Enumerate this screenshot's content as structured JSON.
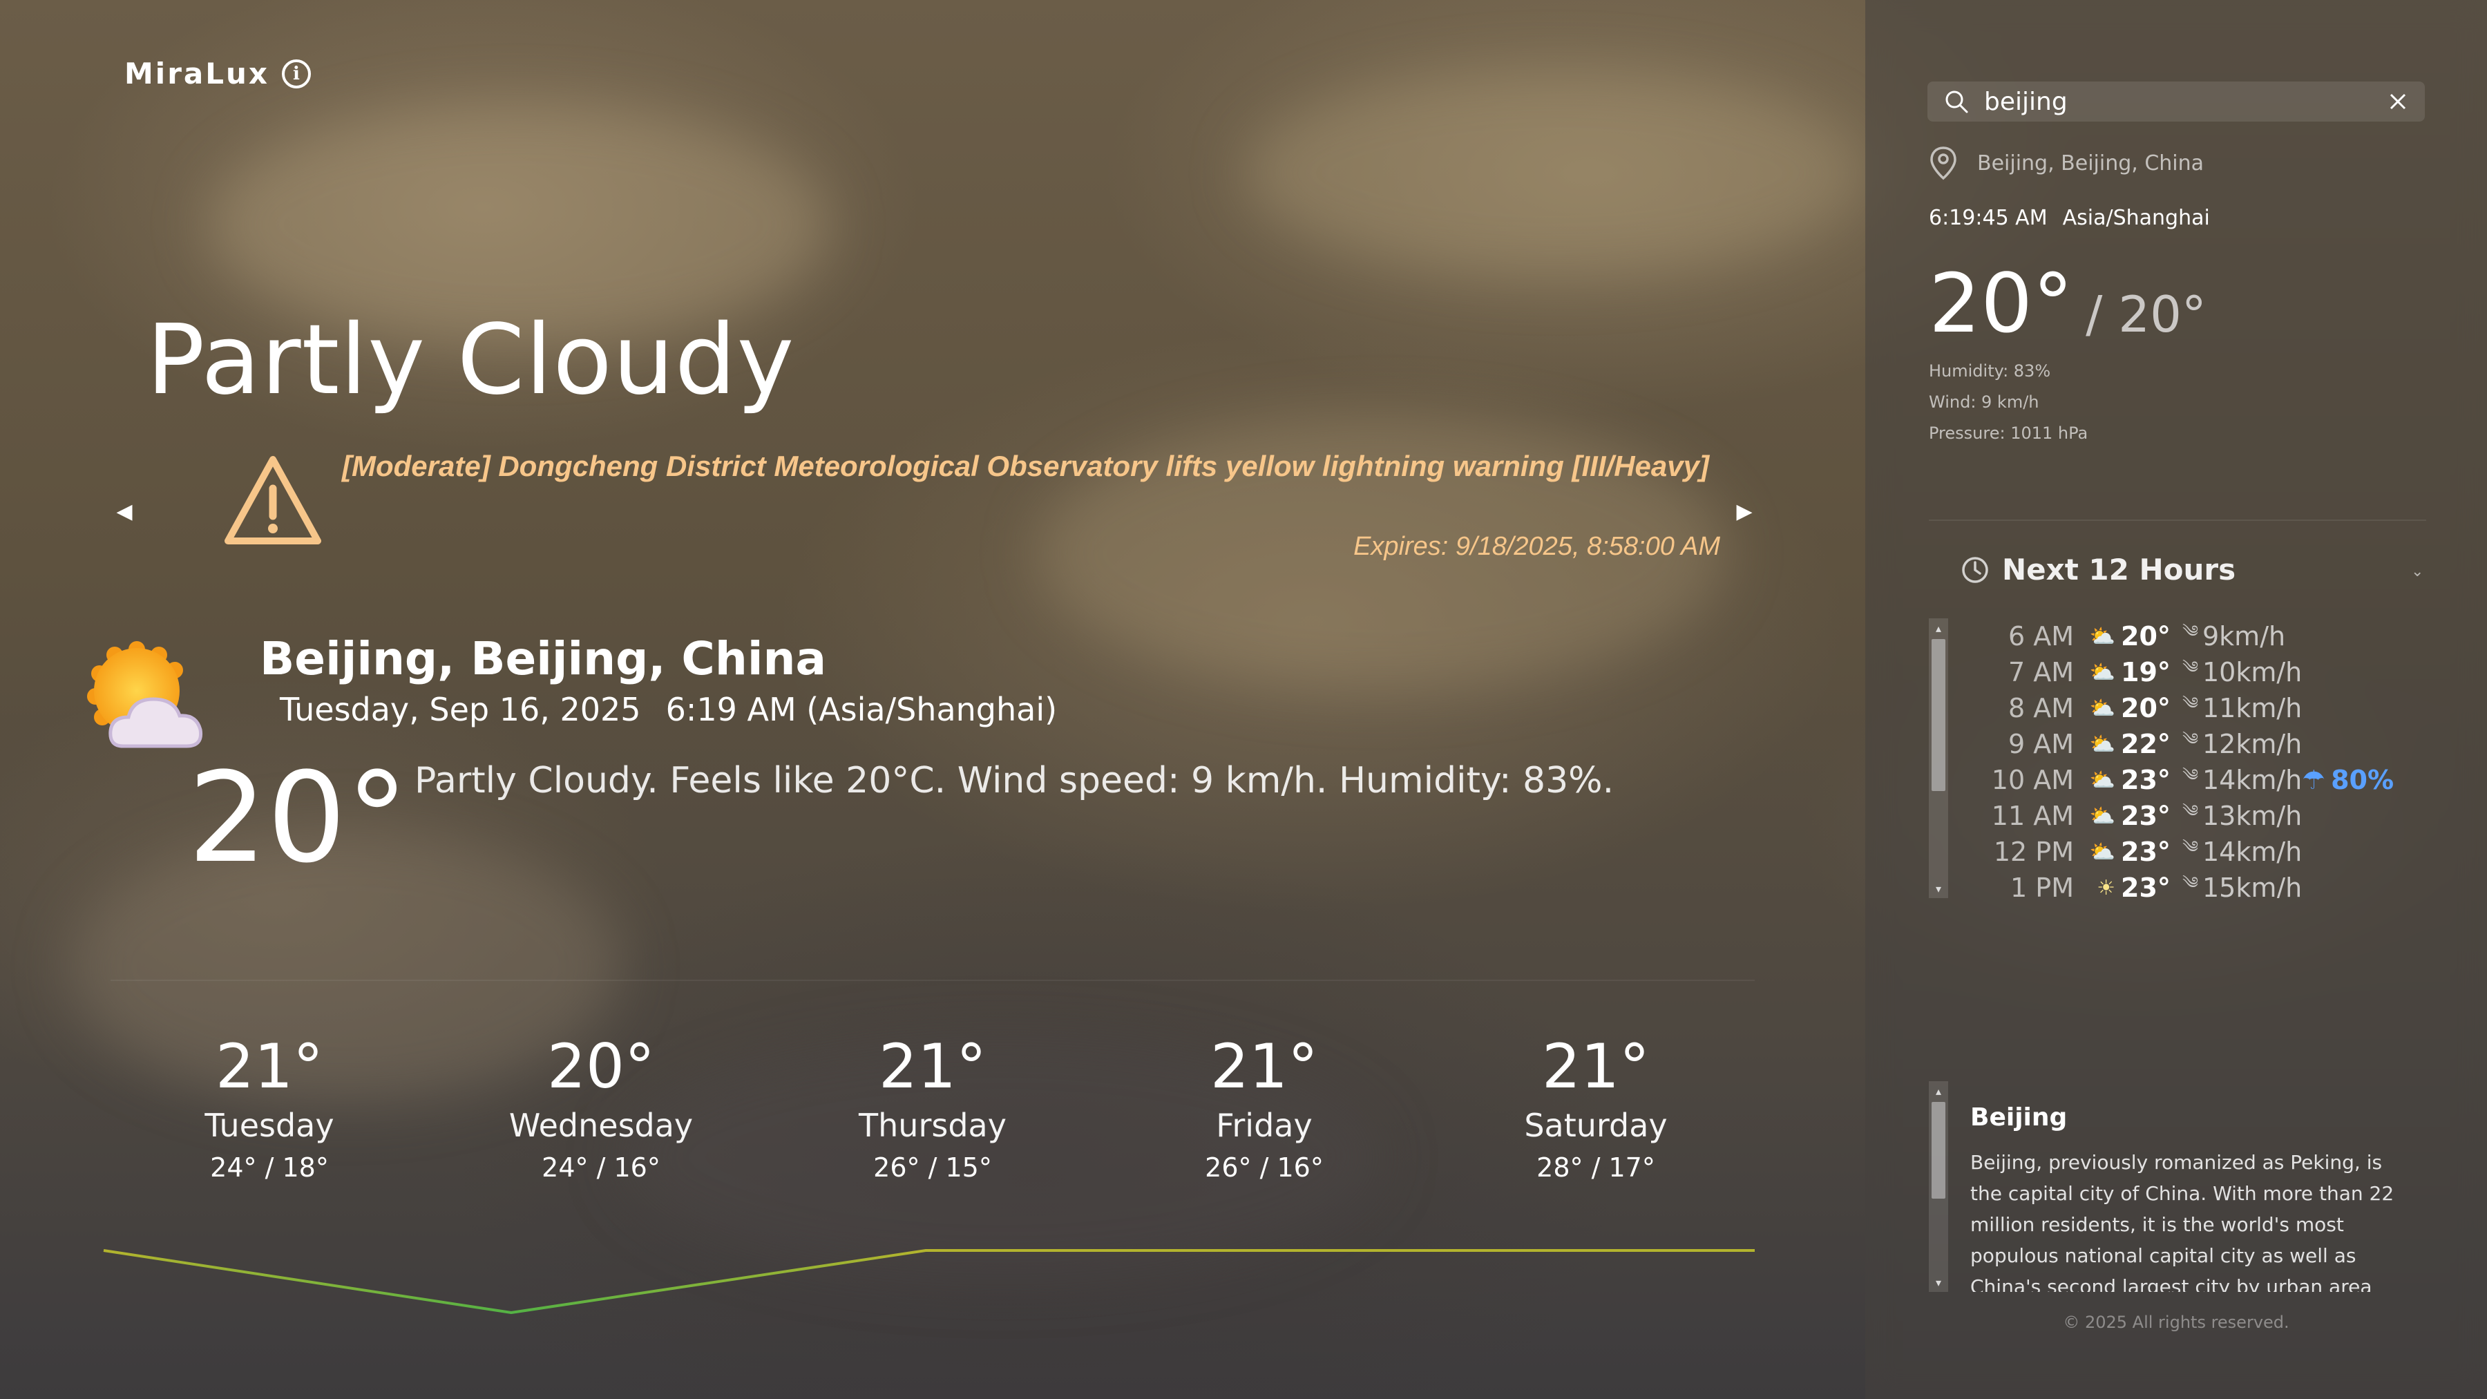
{
  "app": {
    "brand": "MiraLux"
  },
  "current": {
    "condition": "Partly Cloudy",
    "location": "Beijing, Beijing, China",
    "date": "Tuesday, Sep 16, 2025",
    "time": "6:19 AM (Asia/Shanghai)",
    "temp": "20°",
    "summary": "Partly Cloudy. Feels like 20°C. Wind speed: 9 km/h. Humidity: 83%."
  },
  "alert": {
    "text": "[Moderate] Dongcheng District Meteorological Observatory lifts yellow lightning warning [III/Heavy]",
    "expires": "Expires: 9/18/2025, 8:58:00 AM",
    "prev": "◀",
    "next": "▶"
  },
  "forecast": [
    {
      "temp": "21°",
      "day": "Tuesday",
      "range": "24° / 18°"
    },
    {
      "temp": "20°",
      "day": "Wednesday",
      "range": "24° / 16°"
    },
    {
      "temp": "21°",
      "day": "Thursday",
      "range": "26° / 15°"
    },
    {
      "temp": "21°",
      "day": "Friday",
      "range": "26° / 16°"
    },
    {
      "temp": "21°",
      "day": "Saturday",
      "range": "28° / 17°"
    }
  ],
  "panel": {
    "search_value": "beijing",
    "location": "Beijing, Beijing, China",
    "clock_time": "6:19:45 AM",
    "timezone": "Asia/Shanghai",
    "temp": "20°",
    "temp_sub": "/ 20°",
    "humidity": "Humidity: 83%",
    "wind": "Wind: 9 km/h",
    "pressure": "Pressure: 1011 hPa",
    "hours_title": "Next 12 Hours",
    "hours": [
      {
        "time": "6 AM",
        "icon": "cloud-sun-icon",
        "glyph": "⛅",
        "temp": "20°",
        "wind": "9km/h"
      },
      {
        "time": "7 AM",
        "icon": "cloud-sun-icon",
        "glyph": "⛅",
        "temp": "19°",
        "wind": "10km/h"
      },
      {
        "time": "8 AM",
        "icon": "cloud-sun-icon",
        "glyph": "⛅",
        "temp": "20°",
        "wind": "11km/h"
      },
      {
        "time": "9 AM",
        "icon": "cloud-sun-icon",
        "glyph": "⛅",
        "temp": "22°",
        "wind": "12km/h"
      },
      {
        "time": "10 AM",
        "icon": "cloud-sun-icon",
        "glyph": "⛅",
        "temp": "23°",
        "wind": "14km/h",
        "rain": "80%"
      },
      {
        "time": "11 AM",
        "icon": "cloud-sun-icon",
        "glyph": "⛅",
        "temp": "23°",
        "wind": "13km/h"
      },
      {
        "time": "12 PM",
        "icon": "cloud-sun-icon",
        "glyph": "⛅",
        "temp": "23°",
        "wind": "14km/h"
      },
      {
        "time": "1 PM",
        "icon": "sun-icon",
        "glyph": "☀",
        "temp": "23°",
        "wind": "15km/h"
      }
    ],
    "wiki_title": "Beijing",
    "wiki_text": "Beijing, previously romanized as Peking, is the capital city of China. With more than 22 million residents, it is the world's most populous national capital city as well as China's second largest city by urban area after Shanghai. It is"
  },
  "trend_temps": [
    21,
    20,
    21,
    21,
    21
  ],
  "colors": {
    "alert": "#f7c68a",
    "rain": "#5aa0ff",
    "trend_high": "#d4b426",
    "trend_low": "#3fb24a"
  },
  "footer": "© 2025 All rights reserved."
}
